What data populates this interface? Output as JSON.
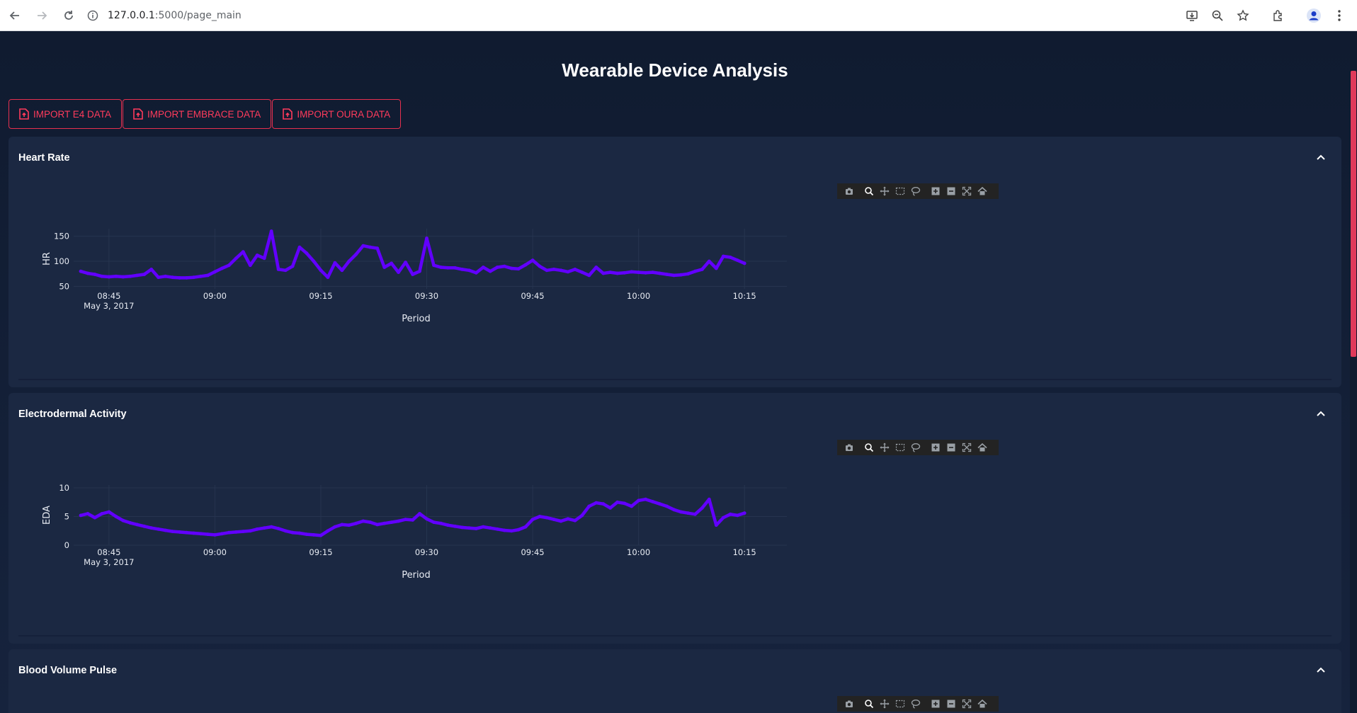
{
  "browser": {
    "url_host": "127.0.0.1",
    "url_path": ":5000/page_main"
  },
  "page": {
    "title": "Wearable Device Analysis"
  },
  "buttons": {
    "import_e4": "IMPORT E4 DATA",
    "import_embrace": "IMPORT EMBRACE DATA",
    "import_oura": "IMPORT OURA DATA"
  },
  "panels": {
    "hr": {
      "title": "Heart Rate"
    },
    "eda": {
      "title": "Electrodermal Activity"
    },
    "bvp": {
      "title": "Blood Volume Pulse"
    }
  },
  "colors": {
    "accent": "#ff3b5c",
    "series": "#6200ff",
    "panel_bg": "#1b2842"
  },
  "chart_data": [
    {
      "type": "line",
      "title": "",
      "xlabel": "Period",
      "ylabel": "HR",
      "x_tick_labels": [
        "08:45",
        "09:00",
        "09:15",
        "09:30",
        "09:45",
        "10:00",
        "10:15"
      ],
      "x_date_label": "May 3, 2017",
      "y_ticks": [
        50,
        100,
        150
      ],
      "ylim": [
        45,
        165
      ],
      "xlim": [
        "08:40",
        "10:21"
      ],
      "series": [
        {
          "x": [
            "08:41",
            "08:42",
            "08:43",
            "08:44",
            "08:45",
            "08:46",
            "08:47",
            "08:48",
            "08:49",
            "08:50",
            "08:51",
            "08:52",
            "08:53",
            "08:54",
            "08:55",
            "08:56",
            "08:57",
            "08:58",
            "08:59",
            "09:00",
            "09:01",
            "09:02",
            "09:03",
            "09:04",
            "09:05",
            "09:06",
            "09:07",
            "09:08",
            "09:09",
            "09:10",
            "09:11",
            "09:12",
            "09:13",
            "09:14",
            "09:15",
            "09:16",
            "09:17",
            "09:18",
            "09:19",
            "09:20",
            "09:21",
            "09:22",
            "09:23",
            "09:24",
            "09:25",
            "09:26",
            "09:27",
            "09:28",
            "09:29",
            "09:30",
            "09:31",
            "09:32",
            "09:33",
            "09:34",
            "09:35",
            "09:36",
            "09:37",
            "09:38",
            "09:39",
            "09:40",
            "09:41",
            "09:42",
            "09:43",
            "09:44",
            "09:45",
            "09:46",
            "09:47",
            "09:48",
            "09:49",
            "09:50",
            "09:51",
            "09:52",
            "09:53",
            "09:54",
            "09:55",
            "09:56",
            "09:57",
            "09:58",
            "09:59",
            "10:00",
            "10:01",
            "10:02",
            "10:03",
            "10:04",
            "10:05",
            "10:06",
            "10:07",
            "10:08",
            "10:09",
            "10:10",
            "10:11",
            "10:12",
            "10:13",
            "10:14",
            "10:15"
          ],
          "values": [
            80,
            76,
            74,
            70,
            69,
            70,
            69,
            70,
            72,
            74,
            84,
            68,
            70,
            68,
            67,
            67,
            68,
            70,
            72,
            79,
            86,
            92,
            106,
            119,
            92,
            112,
            106,
            160,
            84,
            82,
            90,
            128,
            116,
            100,
            82,
            68,
            97,
            82,
            100,
            114,
            131,
            128,
            126,
            88,
            96,
            78,
            98,
            74,
            80,
            146,
            92,
            88,
            87,
            87,
            84,
            82,
            77,
            88,
            80,
            88,
            90,
            86,
            85,
            93,
            102,
            90,
            82,
            84,
            82,
            79,
            84,
            78,
            72,
            88,
            76,
            78,
            76,
            77,
            79,
            78,
            77,
            78,
            76,
            74,
            72,
            73,
            75,
            80,
            84,
            100,
            86,
            110,
            108,
            102,
            96
          ]
        }
      ]
    },
    {
      "type": "line",
      "title": "",
      "xlabel": "Period",
      "ylabel": "EDA",
      "x_tick_labels": [
        "08:45",
        "09:00",
        "09:15",
        "09:30",
        "09:45",
        "10:00",
        "10:15"
      ],
      "x_date_label": "May 3, 2017",
      "y_ticks": [
        0,
        5,
        10
      ],
      "ylim": [
        0,
        10.5
      ],
      "xlim": [
        "08:40",
        "10:21"
      ],
      "series": [
        {
          "x": [
            "08:41",
            "08:42",
            "08:43",
            "08:44",
            "08:45",
            "08:46",
            "08:47",
            "08:48",
            "08:49",
            "08:50",
            "08:51",
            "08:52",
            "08:53",
            "08:54",
            "08:55",
            "08:56",
            "08:57",
            "08:58",
            "08:59",
            "09:00",
            "09:01",
            "09:02",
            "09:03",
            "09:04",
            "09:05",
            "09:06",
            "09:07",
            "09:08",
            "09:09",
            "09:10",
            "09:11",
            "09:12",
            "09:13",
            "09:14",
            "09:15",
            "09:16",
            "09:17",
            "09:18",
            "09:19",
            "09:20",
            "09:21",
            "09:22",
            "09:23",
            "09:24",
            "09:25",
            "09:26",
            "09:27",
            "09:28",
            "09:29",
            "09:30",
            "09:31",
            "09:32",
            "09:33",
            "09:34",
            "09:35",
            "09:36",
            "09:37",
            "09:38",
            "09:39",
            "09:40",
            "09:41",
            "09:42",
            "09:43",
            "09:44",
            "09:45",
            "09:46",
            "09:47",
            "09:48",
            "09:49",
            "09:50",
            "09:51",
            "09:52",
            "09:53",
            "09:54",
            "09:55",
            "09:56",
            "09:57",
            "09:58",
            "09:59",
            "10:00",
            "10:01",
            "10:02",
            "10:03",
            "10:04",
            "10:05",
            "10:06",
            "10:07",
            "10:08",
            "10:09",
            "10:10",
            "10:11",
            "10:12",
            "10:13",
            "10:14",
            "10:15"
          ],
          "values": [
            5.2,
            5.5,
            4.8,
            5.5,
            5.8,
            5.0,
            4.3,
            3.9,
            3.6,
            3.3,
            3.0,
            2.8,
            2.6,
            2.4,
            2.3,
            2.2,
            2.1,
            2.0,
            1.9,
            1.8,
            2.0,
            2.2,
            2.3,
            2.4,
            2.5,
            2.8,
            3.0,
            3.2,
            2.9,
            2.5,
            2.2,
            2.1,
            1.9,
            1.8,
            1.7,
            2.5,
            3.2,
            3.6,
            3.5,
            3.8,
            4.2,
            4.0,
            3.6,
            3.8,
            4.0,
            4.2,
            4.5,
            4.4,
            5.5,
            4.6,
            4.0,
            3.8,
            3.5,
            3.3,
            3.1,
            3.0,
            2.9,
            3.2,
            3.0,
            2.8,
            2.6,
            2.5,
            2.7,
            3.2,
            4.5,
            5.0,
            4.8,
            4.5,
            4.2,
            4.6,
            4.3,
            5.2,
            6.8,
            7.4,
            7.2,
            6.5,
            7.5,
            7.3,
            6.8,
            7.8,
            8.0,
            7.6,
            7.2,
            6.8,
            6.2,
            5.8,
            5.6,
            5.4,
            6.5,
            8.0,
            3.5,
            4.8,
            5.4,
            5.2,
            5.6
          ]
        }
      ]
    }
  ]
}
